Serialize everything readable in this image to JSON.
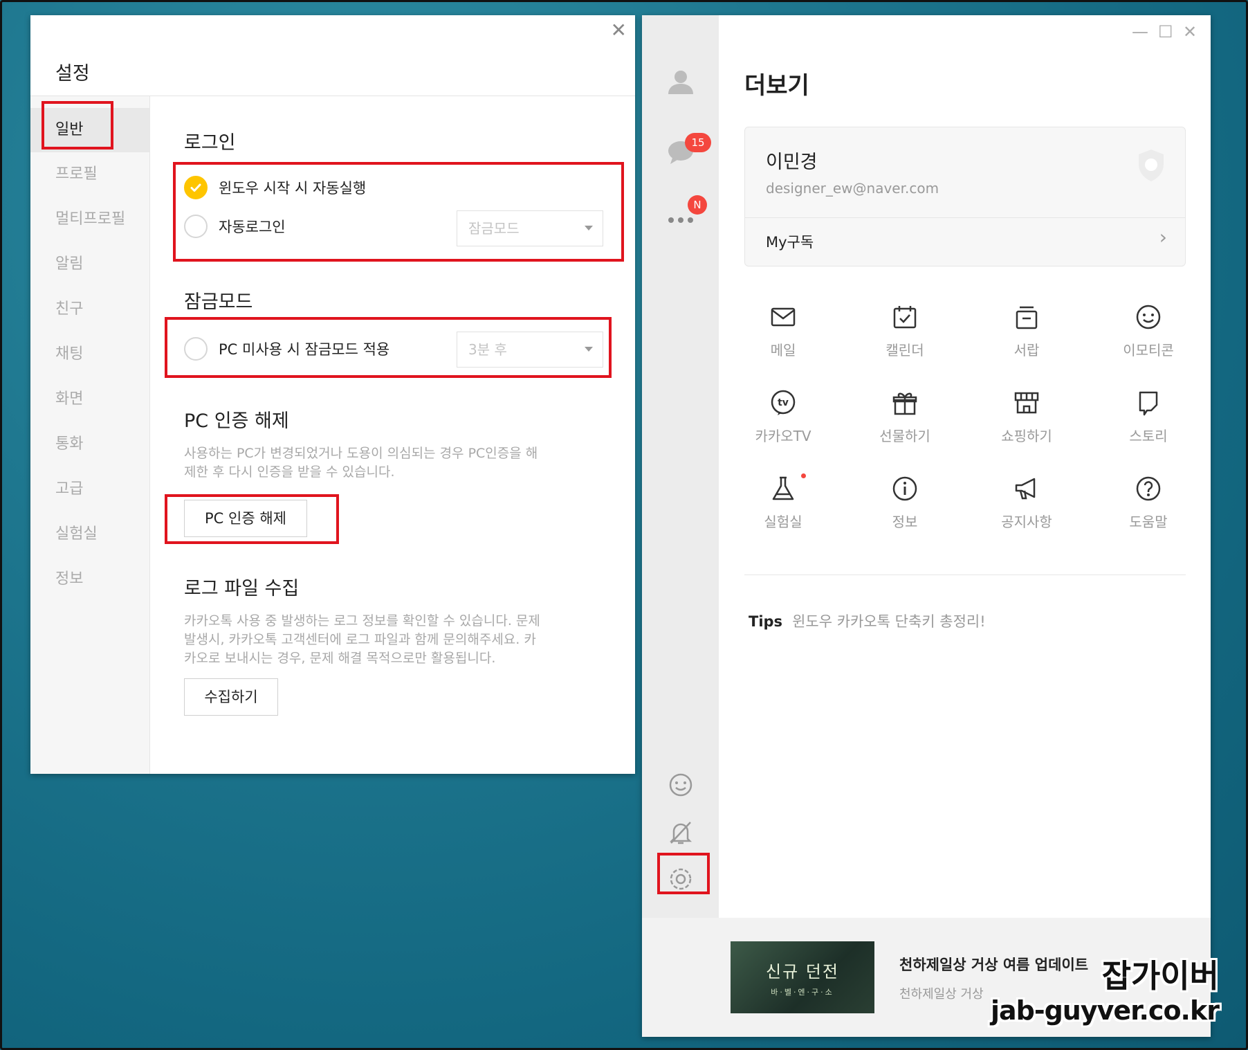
{
  "settings": {
    "title": "설정",
    "nav": [
      "일반",
      "프로필",
      "멀티프로필",
      "알림",
      "친구",
      "채팅",
      "화면",
      "통화",
      "고급",
      "실험실",
      "정보"
    ],
    "login": {
      "heading": "로그인",
      "autostart_label": "윈도우 시작 시 자동실행",
      "autostart_checked": true,
      "autologin_label": "자동로그인",
      "autologin_checked": false,
      "autologin_select": "잠금모드"
    },
    "lock": {
      "heading": "잠금모드",
      "idle_label": "PC 미사용 시 잠금모드 적용",
      "idle_checked": false,
      "idle_select": "3분 후"
    },
    "pc_auth": {
      "heading": "PC 인증 해제",
      "desc_line1": "사용하는 PC가 변경되었거나 도용이 의심되는 경우 PC인증을 해",
      "desc_line2": "제한 후 다시 인증을 받을 수 있습니다.",
      "button": "PC 인증 해제"
    },
    "log": {
      "heading": "로그 파일 수집",
      "desc_line1": "카카오톡 사용 중 발생하는 로그 정보를 확인할 수 있습니다. 문제",
      "desc_line2": " 발생시, 카카오톡 고객센터에 로그 파일과 함께 문의해주세요. 카",
      "desc_line3": "카오로 보내시는 경우, 문제 해결 목적으로만 활용됩니다.",
      "button": "수집하기"
    }
  },
  "more": {
    "title": "더보기",
    "chat_badge": "15",
    "more_badge": "N",
    "profile": {
      "name": "이민경",
      "email": "designer_ew@naver.com",
      "link": "My구독"
    },
    "grid": [
      {
        "label": "메일",
        "icon": "mail-icon"
      },
      {
        "label": "캘린더",
        "icon": "calendar-icon"
      },
      {
        "label": "서랍",
        "icon": "drawer-icon"
      },
      {
        "label": "이모티콘",
        "icon": "emoticon-icon"
      },
      {
        "label": "카카오TV",
        "icon": "tv-icon"
      },
      {
        "label": "선물하기",
        "icon": "gift-icon"
      },
      {
        "label": "쇼핑하기",
        "icon": "shop-icon"
      },
      {
        "label": "스토리",
        "icon": "story-icon"
      },
      {
        "label": "실험실",
        "icon": "flask-icon"
      },
      {
        "label": "정보",
        "icon": "info-icon"
      },
      {
        "label": "공지사항",
        "icon": "megaphone-icon"
      },
      {
        "label": "도움말",
        "icon": "help-icon"
      }
    ],
    "tips_label": "Tips",
    "tips_text": "윈도우 카카오톡 단축키 총정리!",
    "ad": {
      "image_title": "신규 던전",
      "image_sub": "바·벨·엔·구·소",
      "title": "천하제일상 거상 여름 업데이트",
      "sub": "천하제일상 거상"
    }
  },
  "watermark": {
    "line1": "잡가이버",
    "line2": "jab-guyver.co.kr"
  },
  "colors": {
    "accent_yellow": "#fec500",
    "highlight_red": "#e0141e",
    "badge_red": "#f4473e"
  }
}
